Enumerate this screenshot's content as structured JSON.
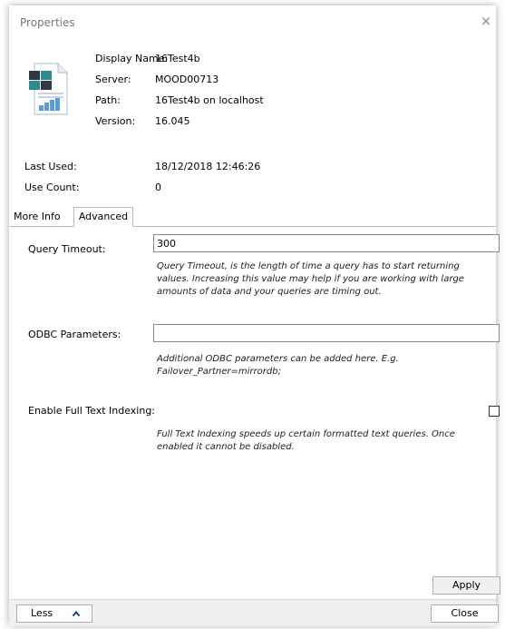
{
  "window": {
    "title": "Properties",
    "close_glyph": "×"
  },
  "header": {
    "icon": "database-document-icon",
    "display_name_label": "Display Name:",
    "display_name_value": "16Test4b",
    "server_label": "Server:",
    "server_value": "MOOD00713",
    "path_label": "Path:",
    "path_value": "16Test4b on localhost",
    "version_label": "Version:",
    "version_value": "16.045"
  },
  "stats": {
    "last_used_label": "Last Used:",
    "last_used_value": "18/12/2018 12:46:26",
    "use_count_label": "Use Count:",
    "use_count_value": "0"
  },
  "tabs": [
    {
      "label": "More Info",
      "active": false
    },
    {
      "label": "Advanced",
      "active": true
    }
  ],
  "advanced": {
    "query_timeout_label": "Query Timeout:",
    "query_timeout_value": "300",
    "query_timeout_help": "Query Timeout, is the length of time a query has to start returning values. Increasing this value may help if you are working with large amounts of data and your queries are timing out.",
    "odbc_label": "ODBC Parameters:",
    "odbc_value": "",
    "odbc_help": "Additional ODBC parameters can be added here. E.g. Failover_Partner=mirrordb;",
    "fulltext_label": "Enable Full Text Indexing:",
    "fulltext_checked": false,
    "fulltext_help": "Full Text Indexing speeds up certain formatted text queries. Once enabled it cannot be disabled.",
    "apply_label": "Apply"
  },
  "footer": {
    "less_label": "Less",
    "less_icon": "chevron-up-icon",
    "close_label": "Close"
  },
  "colors": {
    "icon_dark": "#2d3a45",
    "icon_teal": "#2b8b8d",
    "icon_blue": "#5b9bd5"
  }
}
